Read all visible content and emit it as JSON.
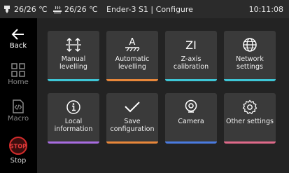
{
  "status": {
    "nozzle_temp": "26/26 ℃",
    "bed_temp": "26/26 ℃",
    "title": "Ender-3 S1 | Configure",
    "time": "10:11:08",
    "nozzle_icon": "nozzle-icon",
    "bed_icon": "heatbed-icon"
  },
  "sidebar": {
    "back": "Back",
    "home": "Home",
    "macro": "Macro",
    "stop": "Stop",
    "stop_badge": "STOP"
  },
  "tiles": [
    {
      "line1": "Manual",
      "line2": "levelling",
      "icon": "manual-level-icon",
      "color": "#3ec6d6"
    },
    {
      "line1": "Automatic",
      "line2": "levelling",
      "icon": "auto-level-icon",
      "color": "#e8873a"
    },
    {
      "line1": "Z-axis",
      "line2": "calibration",
      "icon": "z-offset-icon",
      "color": "#3ec6d6"
    },
    {
      "line1": "Network",
      "line2": "settings",
      "icon": "globe-icon",
      "color": "#3ec6d6"
    },
    {
      "line1": "Local",
      "line2": "information",
      "icon": "info-icon",
      "color": "#a86ce0"
    },
    {
      "line1": "Save",
      "line2": "configuration",
      "icon": "check-icon",
      "color": "#e8873a"
    },
    {
      "line1": "Camera",
      "line2": "",
      "icon": "camera-icon",
      "color": "#4a7be0"
    },
    {
      "line1": "Other settings",
      "line2": "",
      "icon": "settings-gear-icon",
      "color": "#e06a8a"
    }
  ],
  "tile_icon_glyphs": {
    "z_offset": "ZI",
    "auto_level": "A"
  }
}
